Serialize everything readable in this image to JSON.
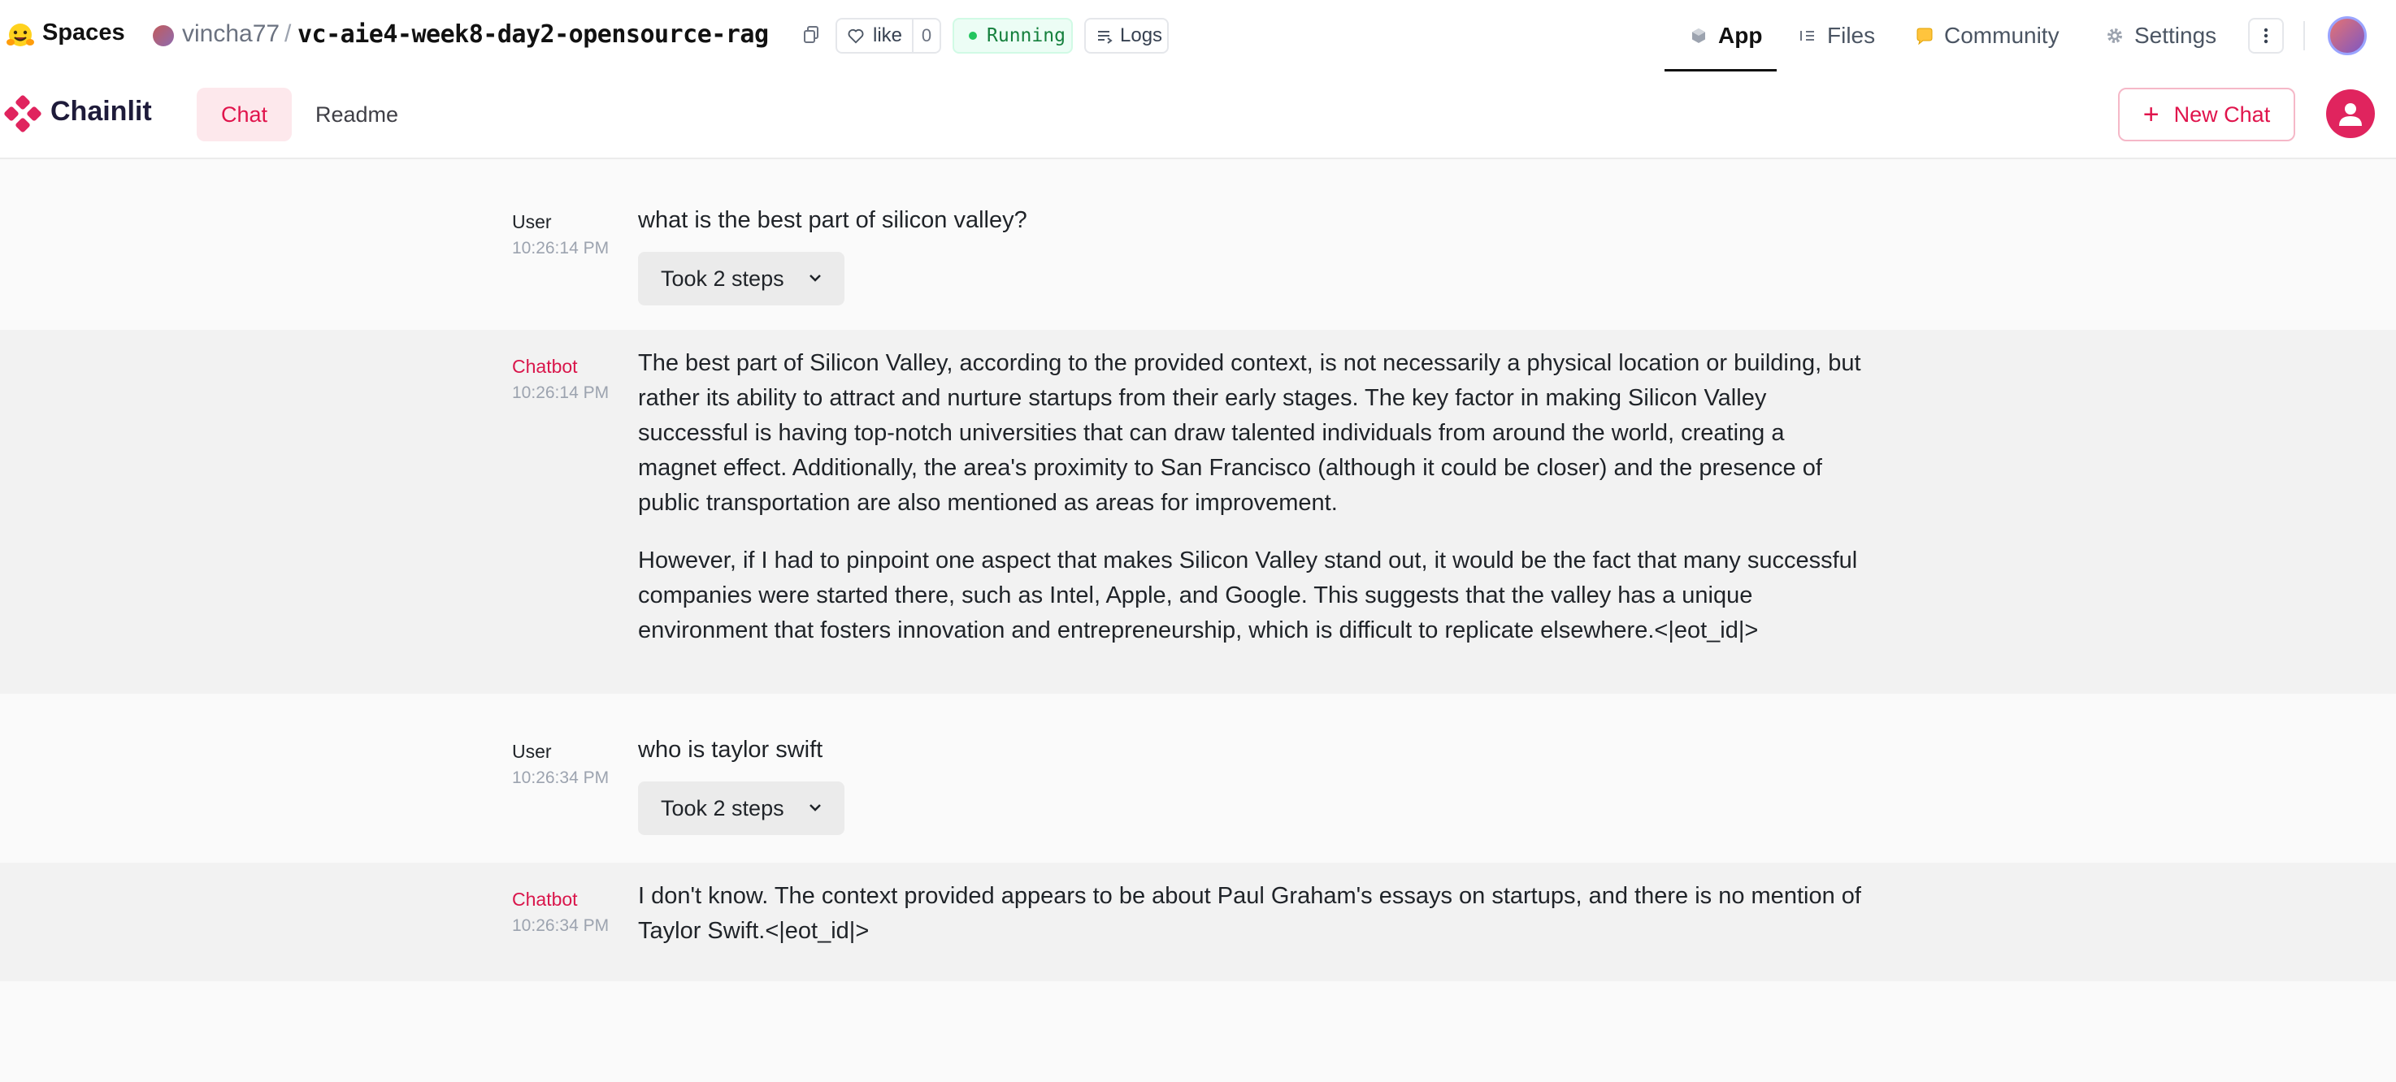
{
  "hf": {
    "spaces_label": "Spaces",
    "owner": "vincha77",
    "separator": "/",
    "repo": "vc-aie4-week8-day2-opensource-rag",
    "like_label": "like",
    "like_count": "0",
    "status": "Running",
    "logs_label": "Logs",
    "tabs": [
      {
        "label": "App",
        "icon": "cube-icon",
        "active": true
      },
      {
        "label": "Files",
        "icon": "files-icon",
        "active": false
      },
      {
        "label": "Community",
        "icon": "community-icon",
        "active": false
      },
      {
        "label": "Settings",
        "icon": "gear-icon",
        "active": false
      }
    ]
  },
  "chainlit": {
    "brand": "Chainlit",
    "tabs": [
      "Chat",
      "Readme"
    ],
    "new_chat_label": "New Chat",
    "accent": "#e0144c"
  },
  "messages": [
    {
      "author": "User",
      "time": "10:26:14 PM",
      "text": "what is the best part of silicon valley?",
      "steps": "Took 2 steps"
    },
    {
      "author": "Chatbot",
      "time": "10:26:14 PM",
      "paragraphs": [
        "The best part of Silicon Valley, according to the provided context, is not necessarily a physical location or building, but rather its ability to attract and nurture startups from their early stages. The key factor in making Silicon Valley successful is having top-notch universities that can draw talented individuals from around the world, creating a magnet effect. Additionally, the area's proximity to San Francisco (although it could be closer) and the presence of public transportation are also mentioned as areas for improvement.",
        "However, if I had to pinpoint one aspect that makes Silicon Valley stand out, it would be the fact that many successful companies were started there, such as Intel, Apple, and Google. This suggests that the valley has a unique environment that fosters innovation and entrepreneurship, which is difficult to replicate elsewhere.<|eot_id|>"
      ]
    },
    {
      "author": "User",
      "time": "10:26:34 PM",
      "text": "who is taylor swift",
      "steps": "Took 2 steps"
    },
    {
      "author": "Chatbot",
      "time": "10:26:34 PM",
      "paragraphs": [
        "I don't know. The context provided appears to be about Paul Graham's essays on startups, and there is no mention of Taylor Swift.<|eot_id|>"
      ]
    }
  ]
}
